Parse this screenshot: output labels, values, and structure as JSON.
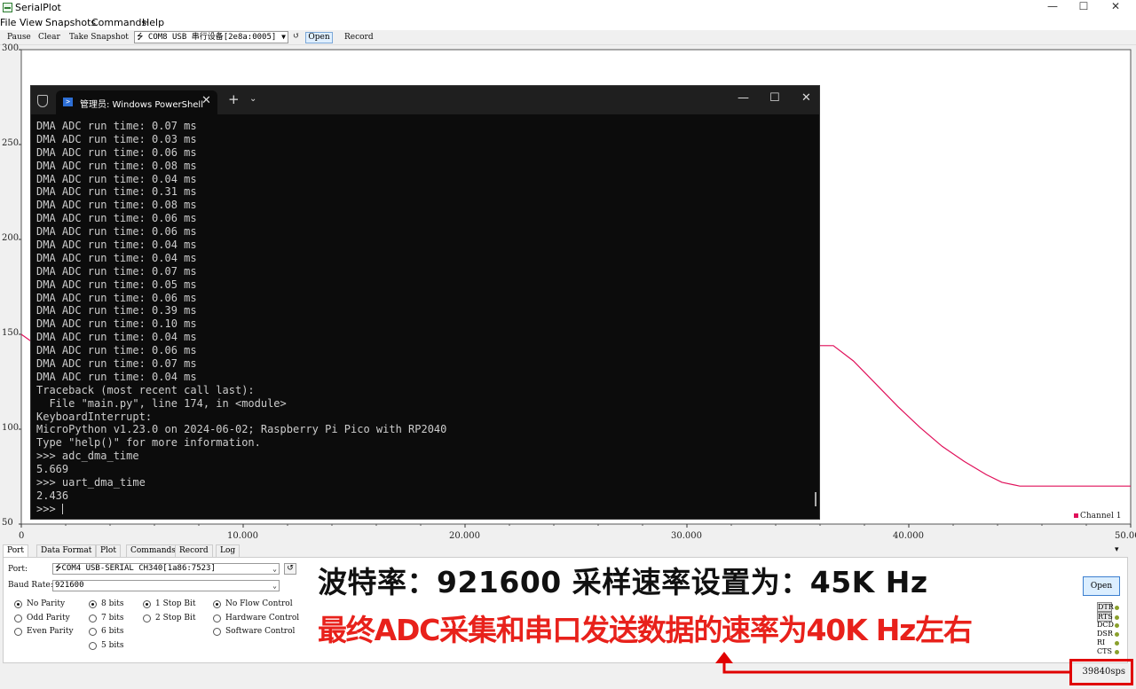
{
  "window": {
    "title": "SerialPlot",
    "controls": {
      "minimize": "—",
      "maximize": "☐",
      "close": "✕"
    }
  },
  "menu": [
    "File",
    "View",
    "Snapshots",
    "Commands",
    "Help"
  ],
  "toolbar": {
    "pause": "Pause",
    "clear": "Clear",
    "snapshot": "Take Snapshot",
    "port": "COM8 USB 串行设备[2e8a:0005]",
    "refresh": "↺",
    "open": "Open",
    "record": "Record"
  },
  "chart_data": {
    "type": "line",
    "xlim": [
      0,
      50
    ],
    "ylim": [
      50,
      300
    ],
    "x_ticks": [
      "0",
      "10.000",
      "20.000",
      "30.000",
      "40.000",
      "50.000"
    ],
    "y_ticks": [
      "300",
      "250",
      "200",
      "150",
      "100",
      "50"
    ],
    "series": [
      {
        "name": "Channel 1",
        "color": "#e0105a",
        "x": [
          0,
          0.6,
          36.6,
          37.5,
          38.5,
          39.5,
          40.5,
          41.5,
          42.5,
          43.5,
          44.2,
          45,
          47,
          50
        ],
        "y": [
          150,
          145,
          144,
          136,
          124,
          112,
          101,
          91,
          83,
          76,
          72,
          70,
          70,
          70
        ]
      }
    ],
    "legend": "bottom-right"
  },
  "powershell": {
    "title": "管理员: Windows PowerShell",
    "tab_close": "✕",
    "new_tab": "+",
    "dropdown": "⌄",
    "minimize": "—",
    "maximize": "☐",
    "close": "✕",
    "lines": [
      "DMA ADC run time: 0.07 ms",
      "DMA ADC run time: 0.03 ms",
      "DMA ADC run time: 0.06 ms",
      "DMA ADC run time: 0.08 ms",
      "DMA ADC run time: 0.04 ms",
      "DMA ADC run time: 0.31 ms",
      "DMA ADC run time: 0.08 ms",
      "DMA ADC run time: 0.06 ms",
      "DMA ADC run time: 0.06 ms",
      "DMA ADC run time: 0.04 ms",
      "DMA ADC run time: 0.04 ms",
      "DMA ADC run time: 0.07 ms",
      "DMA ADC run time: 0.05 ms",
      "DMA ADC run time: 0.06 ms",
      "DMA ADC run time: 0.39 ms",
      "DMA ADC run time: 0.10 ms",
      "DMA ADC run time: 0.04 ms",
      "DMA ADC run time: 0.06 ms",
      "DMA ADC run time: 0.07 ms",
      "DMA ADC run time: 0.04 ms",
      "Traceback (most recent call last):",
      "  File \"main.py\", line 174, in <module>",
      "KeyboardInterrupt:",
      "MicroPython v1.23.0 on 2024-06-02; Raspberry Pi Pico with RP2040",
      "Type \"help()\" for more information.",
      ">>> adc_dma_time",
      "5.669",
      ">>> uart_dma_time",
      "2.436"
    ],
    "prompt": ">>> "
  },
  "tabs": [
    "Port",
    "Data Format",
    "Plot",
    "Commands",
    "Record",
    "Log"
  ],
  "tabs_menu": "▾",
  "port_panel": {
    "port_label": "Port:",
    "port_value": "COM4 USB-SERIAL CH340[1a86:7523]",
    "refresh": "↺",
    "baud_label": "Baud Rate:",
    "baud_value": "921600",
    "parity": [
      "No Parity",
      "Odd Parity",
      "Even Parity"
    ],
    "data_bits": [
      "8 bits",
      "7 bits",
      "6 bits",
      "5 bits"
    ],
    "stop_bits": [
      "1 Stop Bit",
      "2 Stop Bit"
    ],
    "flow": [
      "No Flow Control",
      "Hardware Control",
      "Software Control"
    ],
    "open": "Open",
    "signals": [
      "DTR",
      "RTS",
      "DCD",
      "DSR",
      "RI",
      "CTS"
    ]
  },
  "annotation": {
    "line1": "波特率：921600  采样速率设置为：45K Hz",
    "line2": "最终ADC采集和串口发送数据的速率为40K Hz左右",
    "accent": "#e8211b"
  },
  "status": {
    "sps": "39840sps"
  }
}
